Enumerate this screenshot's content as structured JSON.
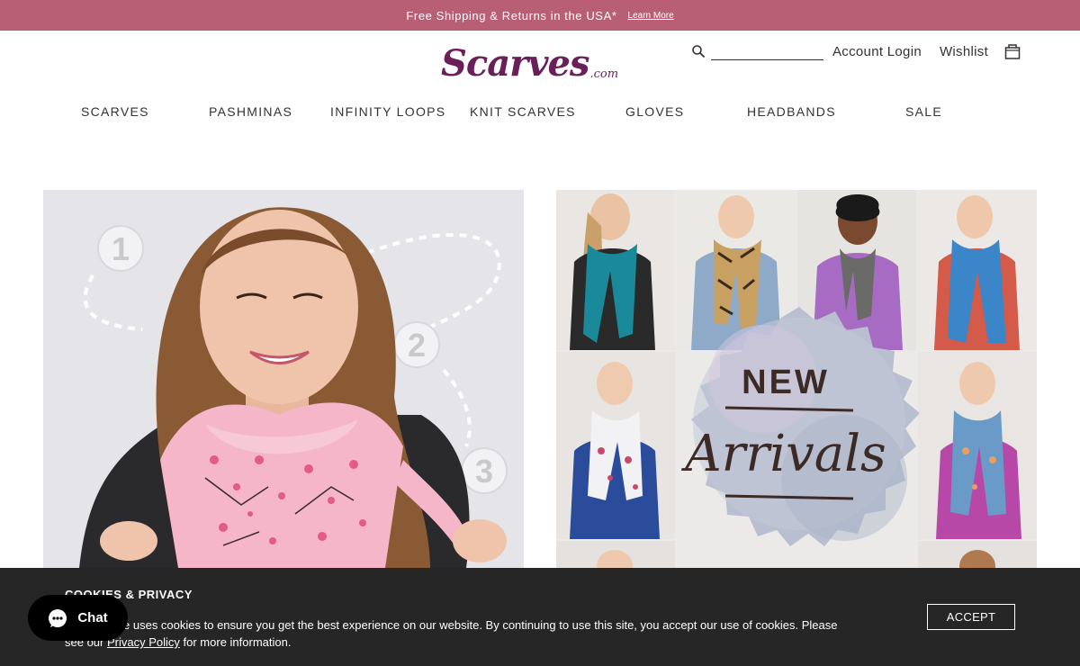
{
  "promo": {
    "text": "Free Shipping & Returns in the USA*",
    "link_label": "Learn More"
  },
  "brand": {
    "logo_main": "Scarves",
    "logo_suffix": ".com",
    "logo_color": "#6b1f59",
    "accent_color": "#b95f75"
  },
  "header": {
    "search_icon": "search-icon",
    "search_value": "",
    "account_label": "Account Login",
    "wishlist_label": "Wishlist",
    "cart_icon": "shopping-bag-icon"
  },
  "nav": {
    "items": [
      {
        "label": "SCARVES"
      },
      {
        "label": "PASHMINAS"
      },
      {
        "label": "INFINITY LOOPS"
      },
      {
        "label": "KNIT SCARVES"
      },
      {
        "label": "GLOVES"
      },
      {
        "label": "HEADBANDS"
      },
      {
        "label": "SALE"
      }
    ]
  },
  "hero_left": {
    "step_1": "1",
    "step_2": "2",
    "step_3": "3"
  },
  "hero_right": {
    "badge_top": "NEW",
    "badge_main": "Arrivals"
  },
  "cookie": {
    "title": "COOKIES & PRIVACY",
    "text_before": "This website uses cookies to ensure you get the best experience on our website. By continuing to use this site, you accept our use of cookies. Please see our ",
    "link_label": "Privacy Policy",
    "text_after": " for more information.",
    "accept_label": "ACCEPT"
  },
  "chat": {
    "icon": "chat-bubble-icon",
    "label": "Chat"
  }
}
